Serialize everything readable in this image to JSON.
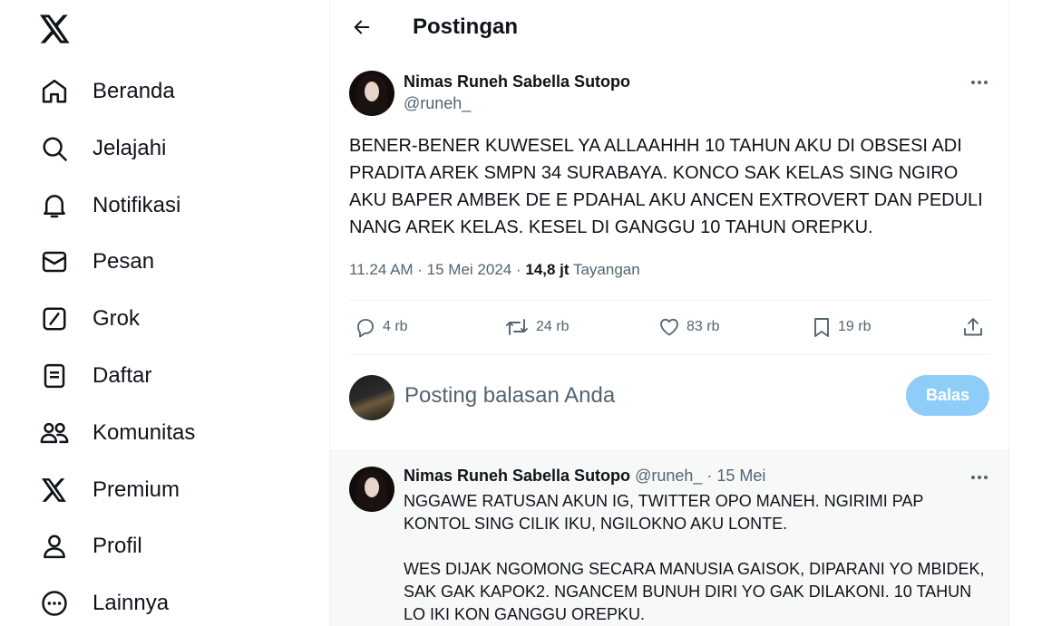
{
  "nav": {
    "logo_icon": "x-logo",
    "items": [
      {
        "label": "Beranda",
        "icon": "home-icon"
      },
      {
        "label": "Jelajahi",
        "icon": "search-icon"
      },
      {
        "label": "Notifikasi",
        "icon": "bell-icon"
      },
      {
        "label": "Pesan",
        "icon": "mail-icon"
      },
      {
        "label": "Grok",
        "icon": "grok-icon"
      },
      {
        "label": "Daftar",
        "icon": "list-icon"
      },
      {
        "label": "Komunitas",
        "icon": "communities-icon"
      },
      {
        "label": "Premium",
        "icon": "x-premium-icon"
      },
      {
        "label": "Profil",
        "icon": "profile-icon"
      },
      {
        "label": "Lainnya",
        "icon": "more-circle-icon"
      }
    ]
  },
  "header": {
    "title": "Postingan"
  },
  "post": {
    "author_name": "Nimas Runeh Sabella Sutopo",
    "handle": "@runeh_",
    "text": "BENER-BENER KUWESEL YA ALLAAHHH 10 TAHUN AKU DI OBSESI ADI PRADITA AREK SMPN 34 SURABAYA. KONCO SAK KELAS SING NGIRO AKU BAPER AMBEK DE E PDAHAL AKU ANCEN EXTROVERT DAN PEDULI NANG AREK KELAS. KESEL DI GANGGU 10 TAHUN OREPKU.",
    "time": "11.24 AM · 15 Mei 2024 · ",
    "views_count": "14,8 jt",
    "views_label": " Tayangan",
    "actions": {
      "replies": "4 rb",
      "reposts": "24 rb",
      "likes": "83 rb",
      "bookmarks": "19 rb"
    }
  },
  "reply_box": {
    "placeholder": "Posting balasan Anda",
    "button": "Balas"
  },
  "reply": {
    "author_name": "Nimas Runeh Sabella Sutopo",
    "handle": "@runeh_",
    "sep": " · ",
    "date": "15 Mei",
    "paragraph1": "NGGAWE RATUSAN AKUN IG, TWITTER OPO MANEH. NGIRIMI PAP KONTOL SING CILIK IKU, NGILOKNO AKU LONTE.",
    "paragraph2": "WES DIJAK NGOMONG SECARA MANUSIA GAISOK, DIPARANI YO MBIDEK, SAK GAK KAPOK2. NGANCEM BUNUH DIRI YO GAK DILAKONI. 10 TAHUN LO IKI KON GANGGU OREPKU."
  }
}
